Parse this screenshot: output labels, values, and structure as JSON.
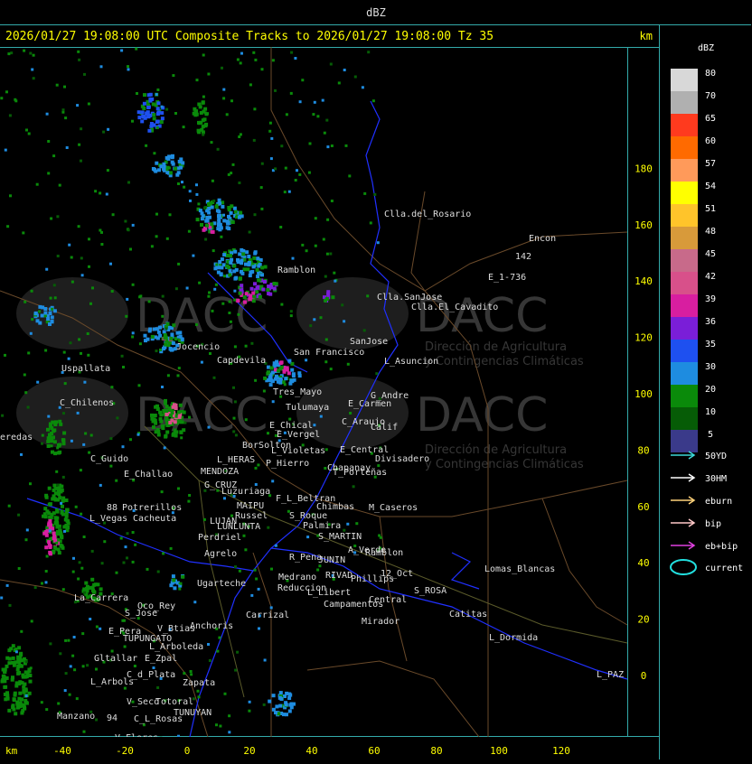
{
  "window": {
    "title": "dBZ"
  },
  "header": {
    "title": "2026/01/27 19:08:00 UTC Composite Tracks to 2026/01/27 19:08:00 Tz 35",
    "unit": "km"
  },
  "axes": {
    "x_unit": "km",
    "x_ticks": [
      -40,
      -20,
      0,
      20,
      40,
      60,
      80,
      100,
      120
    ],
    "y_ticks": [
      180,
      160,
      140,
      120,
      100,
      80,
      60,
      40,
      20,
      0
    ]
  },
  "legend": {
    "title": "dBZ",
    "scale": [
      {
        "label": "80",
        "color": "#d8d8d8"
      },
      {
        "label": "70",
        "color": "#b0b0b0"
      },
      {
        "label": "65",
        "color": "#ff3a1e"
      },
      {
        "label": "60",
        "color": "#ff6a00"
      },
      {
        "label": "57",
        "color": "#ff9a5a"
      },
      {
        "label": "54",
        "color": "#ffff00"
      },
      {
        "label": "51",
        "color": "#ffc42a"
      },
      {
        "label": "48",
        "color": "#d89a3a"
      },
      {
        "label": "45",
        "color": "#c86a8a"
      },
      {
        "label": "42",
        "color": "#d8508a"
      },
      {
        "label": "39",
        "color": "#d81ea0"
      },
      {
        "label": "36",
        "color": "#7a1ed8"
      },
      {
        "label": "35",
        "color": "#1e50f0"
      },
      {
        "label": "30",
        "color": "#1e8ce0"
      },
      {
        "label": "20",
        "color": "#0a8a0a"
      },
      {
        "label": "10",
        "color": "#065c06"
      },
      {
        "label": "5",
        "color": "#3a3a8a"
      }
    ],
    "tracks": [
      {
        "label": "50YD",
        "color": "#3cd8d8"
      },
      {
        "label": "30HM",
        "color": "#ffffff"
      },
      {
        "label": "eburn",
        "color": "#ffd27a"
      },
      {
        "label": "bip",
        "color": "#ffc8c8"
      },
      {
        "label": "eb+bip",
        "color": "#e040e0"
      }
    ],
    "current": {
      "label": "current",
      "color": "#22e0e0"
    }
  },
  "watermark": {
    "brand": "DACC",
    "line1": "Dirección de Agricultura",
    "line2": "y Contingencias Climáticas"
  },
  "places": [
    {
      "name": "Clla.del_Rosario"
    },
    {
      "name": "Encon"
    },
    {
      "name": "142"
    },
    {
      "name": "E_1-736"
    },
    {
      "name": "Ramblon"
    },
    {
      "name": "Clla.SanJose"
    },
    {
      "name": "Clla.El_Cavadito"
    },
    {
      "name": "Uspallata"
    },
    {
      "name": "Jocencio"
    },
    {
      "name": "Capdevila"
    },
    {
      "name": "San Francisco"
    },
    {
      "name": "SanJose"
    },
    {
      "name": "L_Asuncion"
    },
    {
      "name": "C_Chilenos"
    },
    {
      "name": "Tres_Mayo"
    },
    {
      "name": "Tulumaya"
    },
    {
      "name": "E_Carmen"
    },
    {
      "name": "G_Andre"
    },
    {
      "name": "eredas"
    },
    {
      "name": "E_Chical"
    },
    {
      "name": "E_Vergel"
    },
    {
      "name": "C_Araujo"
    },
    {
      "name": "Calif"
    },
    {
      "name": "BorSolton"
    },
    {
      "name": "L_Violetas"
    },
    {
      "name": "E_Central"
    },
    {
      "name": "Divisadero"
    },
    {
      "name": "C_Guido"
    },
    {
      "name": "L_HERAS"
    },
    {
      "name": "P_Hierro"
    },
    {
      "name": "T_Porteñas"
    },
    {
      "name": "MENDOZA"
    },
    {
      "name": "E_Challao"
    },
    {
      "name": "G_CRUZ"
    },
    {
      "name": "Luzuriaga"
    },
    {
      "name": "Chapanay"
    },
    {
      "name": "F_L_Beltran"
    },
    {
      "name": "M_Caseros"
    },
    {
      "name": "88"
    },
    {
      "name": "Potrerillos"
    },
    {
      "name": "MAIPU"
    },
    {
      "name": "Chimbas"
    },
    {
      "name": "L_Vegas"
    },
    {
      "name": "Cacheuta"
    },
    {
      "name": "Russel"
    },
    {
      "name": "S_Roque"
    },
    {
      "name": "LUJAN"
    },
    {
      "name": "Palmira"
    },
    {
      "name": "LUNLUNTA"
    },
    {
      "name": "S_MARTIN"
    },
    {
      "name": "Perdriel"
    },
    {
      "name": "A_Verde"
    },
    {
      "name": "Ramblon"
    },
    {
      "name": "Agrelo"
    },
    {
      "name": "R_Pena"
    },
    {
      "name": "JUNIN"
    },
    {
      "name": "12_Oct"
    },
    {
      "name": "Lomas_Blancas"
    },
    {
      "name": "Ugarteche"
    },
    {
      "name": "Medrano"
    },
    {
      "name": "RIVAD"
    },
    {
      "name": "Phillips"
    },
    {
      "name": "Reduccion"
    },
    {
      "name": "L_Libert"
    },
    {
      "name": "S_ROSA"
    },
    {
      "name": "La_Carrera"
    },
    {
      "name": "Oco_Rey"
    },
    {
      "name": "Campamentos"
    },
    {
      "name": "Central"
    },
    {
      "name": "S_Jose"
    },
    {
      "name": "Carrizal"
    },
    {
      "name": "Catitas"
    },
    {
      "name": "Anchoris"
    },
    {
      "name": "Mirador"
    },
    {
      "name": "E_Pera"
    },
    {
      "name": "V_Btias"
    },
    {
      "name": "TUPUNGATO"
    },
    {
      "name": "L_Dormida"
    },
    {
      "name": "L_Arboleda"
    },
    {
      "name": "Gltallar"
    },
    {
      "name": "E_Zpal"
    },
    {
      "name": "L_Arbols"
    },
    {
      "name": "C_d_Plata"
    },
    {
      "name": "Zapata"
    },
    {
      "name": "L_PAZ"
    },
    {
      "name": "V_Seco"
    },
    {
      "name": "Totoral"
    },
    {
      "name": "Manzano"
    },
    {
      "name": "94"
    },
    {
      "name": "TUNUYAN"
    },
    {
      "name": "C_L_Rosas"
    },
    {
      "name": "V_Flores"
    }
  ]
}
